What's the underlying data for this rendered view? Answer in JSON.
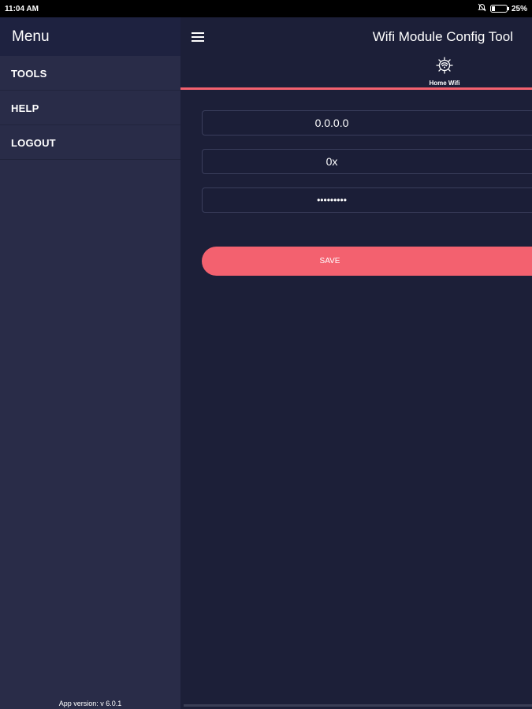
{
  "statusbar": {
    "time": "11:04 AM",
    "battery": "25%",
    "battery_level": 0.25
  },
  "drawer": {
    "title": "Menu",
    "items": [
      {
        "label": "TOOLS"
      },
      {
        "label": "HELP"
      },
      {
        "label": "LOGOUT"
      }
    ],
    "version": "App version: v 6.0.1"
  },
  "appbar": {
    "title": "Wifi Module Config Tool",
    "tab_label": "Home Wifi"
  },
  "form": {
    "ip_value": "0.0.0.0",
    "hex_value": "0x",
    "password_value": "•••••••••",
    "save_label": "SAVE"
  },
  "colors": {
    "accent": "#f3616f",
    "background": "#1c1f38",
    "drawer": "#292c48"
  }
}
